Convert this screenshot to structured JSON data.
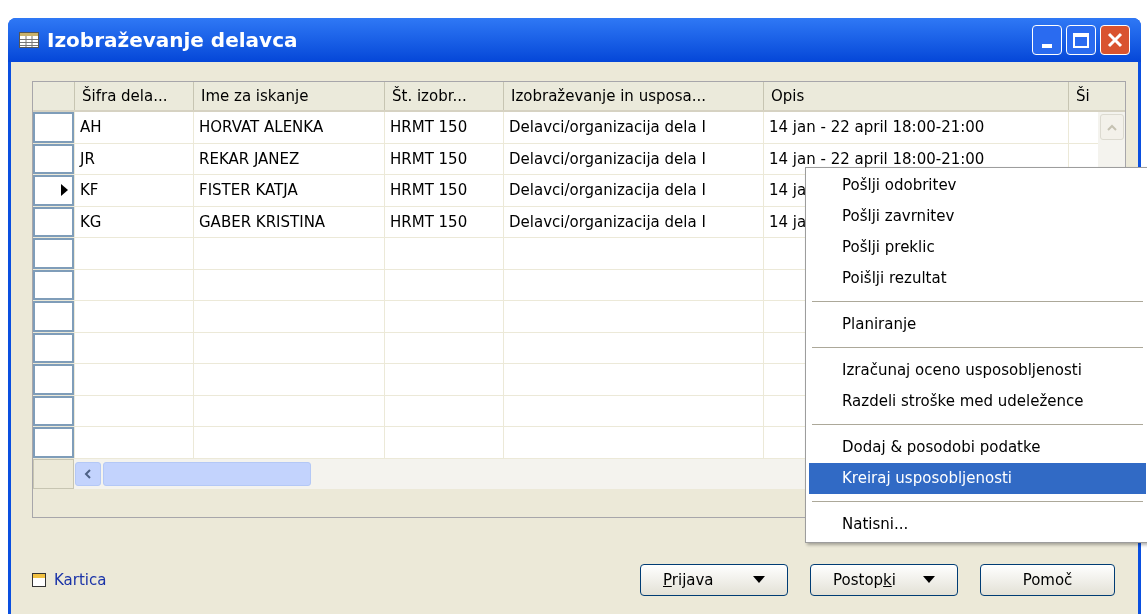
{
  "window": {
    "title": "Izobraževanje delavca"
  },
  "table": {
    "columns": [
      "Šifra dela...",
      "Ime za iskanje",
      "Št. izobr...",
      "Izobraževanje in usposa...",
      "Opis",
      "Ši"
    ],
    "rows": [
      {
        "selected": false,
        "cells": [
          "AH",
          "HORVAT ALENKA",
          "HRMT 150",
          "Delavci/organizacija dela I",
          "14 jan - 22 april 18:00-21:00"
        ]
      },
      {
        "selected": false,
        "cells": [
          "JR",
          "REKAR JANEZ",
          "HRMT 150",
          "Delavci/organizacija dela I",
          "14 jan - 22 april 18:00-21:00"
        ]
      },
      {
        "selected": true,
        "cells": [
          "KF",
          "FISTER KATJA",
          "HRMT 150",
          "Delavci/organizacija dela I",
          "14 ja"
        ]
      },
      {
        "selected": false,
        "cells": [
          "KG",
          "GABER KRISTINA",
          "HRMT 150",
          "Delavci/organizacija dela I",
          "14 ja"
        ]
      }
    ]
  },
  "card_link": {
    "label": "Kartica"
  },
  "buttons": [
    {
      "kind": "menu",
      "key": "P",
      "after": "rijava"
    },
    {
      "kind": "menu",
      "before": "Postop",
      "key": "k",
      "after": "i"
    },
    {
      "kind": "plain",
      "before": "Pomoč"
    }
  ],
  "context_menu": {
    "items": [
      {
        "kind": "item",
        "label": "Pošlji odobritev",
        "selected": false
      },
      {
        "kind": "item",
        "label": "Pošlji zavrnitev",
        "selected": false
      },
      {
        "kind": "item",
        "label": "Pošlji preklic",
        "selected": false
      },
      {
        "kind": "item",
        "label": "Poišlji rezultat",
        "selected": false
      },
      {
        "kind": "separator"
      },
      {
        "kind": "item",
        "label": "Planiranje",
        "selected": false
      },
      {
        "kind": "separator"
      },
      {
        "kind": "item",
        "label": "Izračunaj oceno usposobljenosti",
        "selected": false
      },
      {
        "kind": "item",
        "label": "Razdeli stroške med udeležence",
        "selected": false
      },
      {
        "kind": "separator"
      },
      {
        "kind": "item",
        "label": "Dodaj & posodobi podatke",
        "selected": false
      },
      {
        "kind": "item",
        "label": "Kreiraj usposobljenosti",
        "selected": true
      },
      {
        "kind": "separator"
      },
      {
        "kind": "item",
        "label": "Natisni...",
        "selected": false
      }
    ]
  }
}
